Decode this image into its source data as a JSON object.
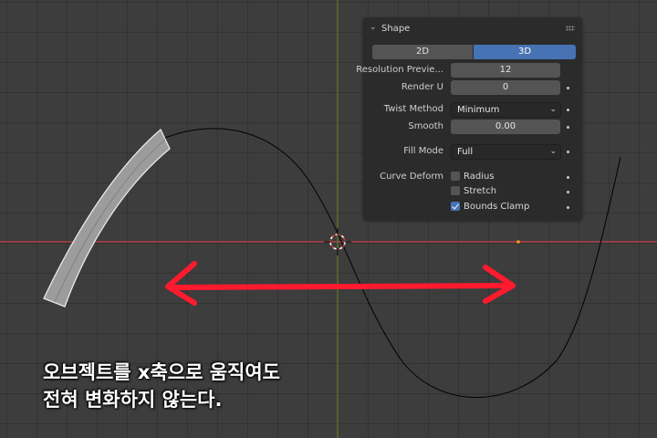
{
  "panel": {
    "title": "Shape",
    "modes": [
      "2D",
      "3D"
    ],
    "active_mode": "3D",
    "resolution_preview": {
      "label": "Resolution Previe...",
      "value": "12"
    },
    "render_u": {
      "label": "Render U",
      "value": "0"
    },
    "twist_method": {
      "label": "Twist Method",
      "value": "Minimum"
    },
    "smooth": {
      "label": "Smooth",
      "value": "0.00"
    },
    "fill_mode": {
      "label": "Fill Mode",
      "value": "Full"
    },
    "curve_deform": {
      "label": "Curve Deform",
      "options": [
        {
          "label": "Radius",
          "checked": false
        },
        {
          "label": "Stretch",
          "checked": false
        },
        {
          "label": "Bounds Clamp",
          "checked": true
        }
      ]
    }
  },
  "caption": {
    "line1": "오브젝트를 x축으로 움직여도",
    "line2": "전혀 변화하지 않는다."
  },
  "colors": {
    "viewport_bg": "#3d3d3d",
    "x_axis": "#c4414d",
    "y_axis": "#6b8e23",
    "arrow": "#ff1a2e",
    "active_blue": "#4772b3",
    "deformed_object": "#9a9a9a",
    "curve": "#000000"
  },
  "icons": [
    "chevron-down-icon",
    "drag-handle-icon",
    "3d-cursor-icon",
    "origin-dot-icon",
    "double-arrow-icon"
  ]
}
